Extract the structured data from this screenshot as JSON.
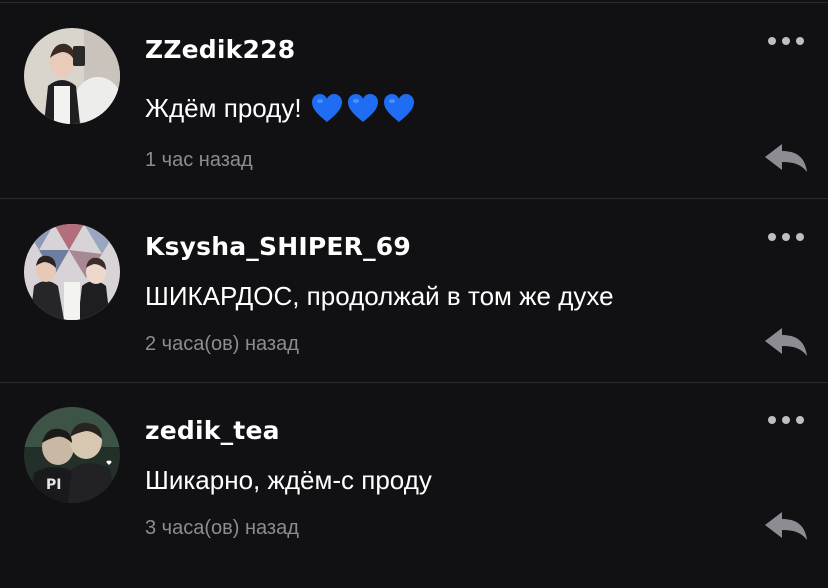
{
  "comments": [
    {
      "username": "ZZedik228",
      "text": "Ждём проду!",
      "emojis": [
        "blue-heart",
        "blue-heart",
        "blue-heart"
      ],
      "time": "1 час назад"
    },
    {
      "username": "Ksysha_SHIPER_69",
      "text": "ШИКАРДОС, продолжай в том же духе",
      "emojis": [],
      "time": "2 часа(ов) назад"
    },
    {
      "username": "zedik_tea",
      "text": "Шикарно, ждём-с проду",
      "emojis": [],
      "time": "3 часа(ов) назад"
    }
  ],
  "icons": {
    "more": "more-dots-icon",
    "reply": "reply-arrow-icon",
    "heart": "blue-heart-icon"
  },
  "colors": {
    "background": "#111013",
    "text": "#ffffff",
    "muted": "#8d8c92",
    "heart": "#1f6df2",
    "divider": "#2b2a2f"
  }
}
